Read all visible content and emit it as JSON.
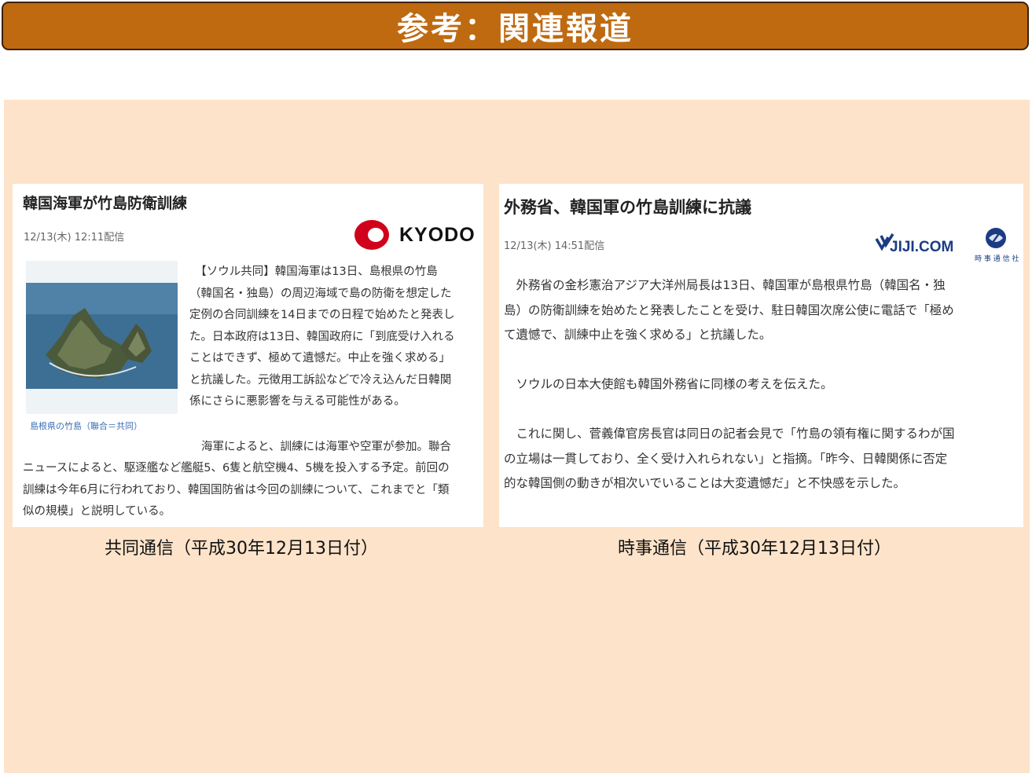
{
  "header": {
    "title": "参考：関連報道"
  },
  "kyodo": {
    "headline": "韓国海軍が竹島防衛訓練",
    "date": "12/13(木) 12:11配信",
    "logo_text": "KYODO",
    "photo_caption": "島根県の竹島（聯合＝共同）",
    "body_lines": [
      "　【ソウル共同】韓国海軍は13日、島根県の竹島",
      "（韓国名・独島）の周辺海域で島の防衛を想定した",
      "定例の合同訓練を14日までの日程で始めたと発表し",
      "た。日本政府は13日、韓国政府に「到底受け入れる",
      "ことはできず、極めて遺憾だ。中止を強く求める」",
      "と抗議した。元徴用工訴訟などで冷え込んだ日韓関",
      "係にさらに悪影響を与える可能性がある。"
    ],
    "body2_line1": "海軍によると、訓練には海軍や空軍が参加。聯合",
    "body2_lines": [
      "ニュースによると、駆逐艦など艦艇5、6隻と航空機4、5機を投入する予定。前回の",
      "訓練は今年6月に行われており、韓国国防省は今回の訓練について、これまでと「類",
      "似の規模」と説明している。"
    ],
    "source_label": "共同通信（平成30年12月13日付）"
  },
  "jiji": {
    "headline": "外務省、韓国軍の竹島訓練に抗議",
    "date": "12/13(木) 14:51配信",
    "logo_text": "JIJI.COM",
    "logo_sub": "時 事 通 信 社",
    "para1": [
      "　外務省の金杉憲治アジア大洋州局長は13日、韓国軍が島根県竹島（韓国名・独",
      "島）の防衛訓練を始めたと発表したことを受け、駐日韓国次席公使に電話で「極め",
      "て遺憾で、訓練中止を強く求める」と抗議した。"
    ],
    "para2": "　ソウルの日本大使館も韓国外務省に同様の考えを伝えた。",
    "para3": [
      "　これに関し、菅義偉官房長官は同日の記者会見で「竹島の領有権に関するわが国",
      "の立場は一貫しており、全く受け入れられない」と指摘。「昨今、日韓関係に否定",
      "的な韓国側の動きが相次いでいることは大変遺憾だ」と不快感を示した。"
    ],
    "source_label": "時事通信（平成30年12月13日付）"
  },
  "colors": {
    "banner": "#bf6a10",
    "panel": "#fde3c9",
    "kyodo_red": "#d0021b",
    "jiji_blue": "#1b3c84"
  },
  "icons": {
    "kyodo_logo": "kyodo-logo-icon",
    "jiji_logo": "jiji-logo-icon"
  }
}
